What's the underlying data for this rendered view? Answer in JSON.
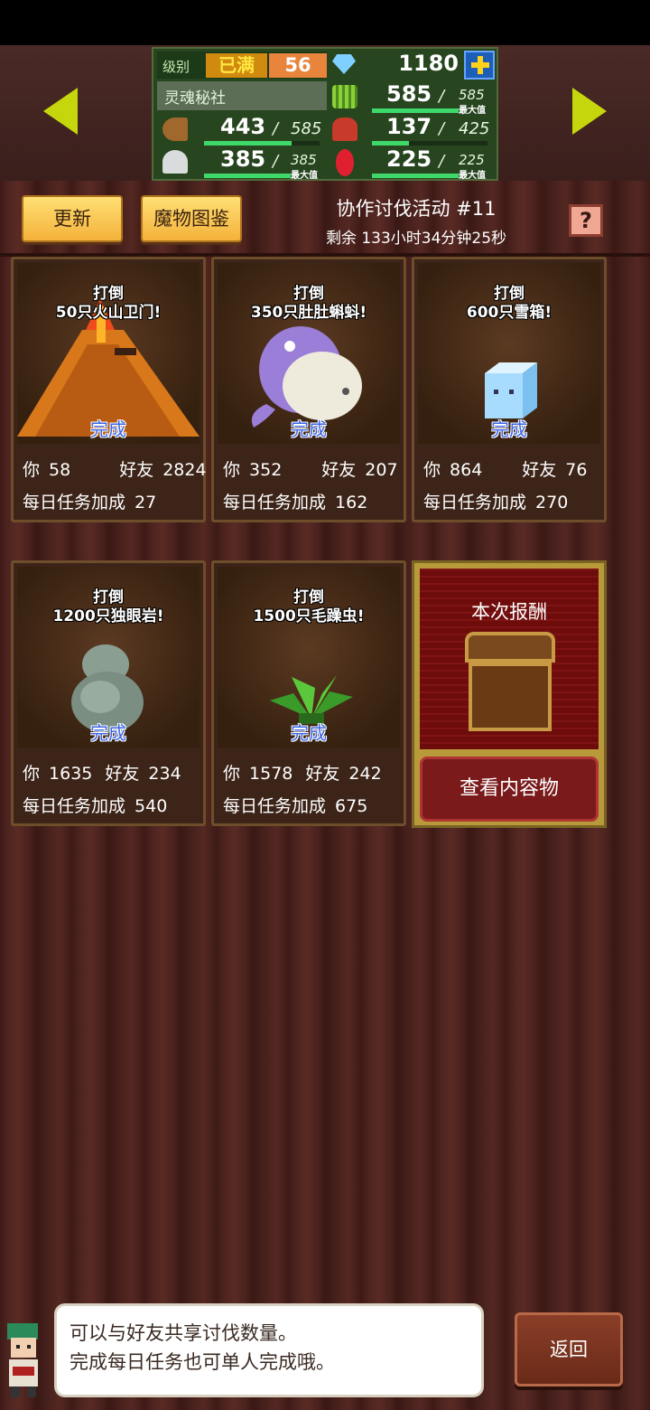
{
  "hud": {
    "level_label": "级别",
    "level_status": "已满",
    "level": "56",
    "gems": "1180",
    "club": "灵魂秘社",
    "grass": "585",
    "grass_max": "585",
    "wood": "443",
    "wood_max": "585",
    "people": "137",
    "people_max": "425",
    "ore": "385",
    "ore_max": "385",
    "ruby": "225",
    "ruby_max": "225",
    "max_tag": "最大值",
    "wood_fill": 0.76,
    "people_fill": 0.32
  },
  "toolbar": {
    "refresh_label": "更新",
    "monster_book_label": "魔物图鉴",
    "help_label": "?"
  },
  "event": {
    "title": "协作讨伐活动 #11",
    "time_left": "剩余 133小时34分钟25秒"
  },
  "quests": [
    {
      "title_line1": "打倒",
      "title_line2": "50只火山卫门!",
      "status": "完成",
      "you_label": "你",
      "you": "58",
      "friend_label": "好友",
      "friend": "2824",
      "daily_label": "每日任务加成",
      "daily": "27",
      "sprite": "volcano-monster-icon"
    },
    {
      "title_line1": "打倒",
      "title_line2": "350只肚肚蝌蚪!",
      "status": "完成",
      "you_label": "你",
      "you": "352",
      "friend_label": "好友",
      "friend": "207",
      "daily_label": "每日任务加成",
      "daily": "162",
      "sprite": "tadpole-monster-icon"
    },
    {
      "title_line1": "打倒",
      "title_line2": "600只雪箱!",
      "status": "完成",
      "you_label": "你",
      "you": "864",
      "friend_label": "好友",
      "friend": "76",
      "daily_label": "每日任务加成",
      "daily": "270",
      "sprite": "ice-cube-monster-icon"
    },
    {
      "title_line1": "打倒",
      "title_line2": "1200只独眼岩!",
      "status": "完成",
      "you_label": "你",
      "you": "1635",
      "friend_label": "好友",
      "friend": "234",
      "daily_label": "每日任务加成",
      "daily": "540",
      "sprite": "rock-monster-icon"
    },
    {
      "title_line1": "打倒",
      "title_line2": "1500只毛躁虫!",
      "status": "完成",
      "you_label": "你",
      "you": "1578",
      "friend_label": "好友",
      "friend": "242",
      "daily_label": "每日任务加成",
      "daily": "675",
      "sprite": "plant-monster-icon"
    }
  ],
  "reward": {
    "title": "本次报酬",
    "view_label": "查看内容物"
  },
  "tip": {
    "line1": "可以与好友共享讨伐数量。",
    "line2": "完成每日任务也可单人完成哦。"
  },
  "back_label": "返回",
  "colors": {
    "accent_yellow": "#f4b23a",
    "done_blue": "#3a64e8",
    "bar_green": "#3fd86a",
    "arrow_green": "#c6d60c"
  }
}
